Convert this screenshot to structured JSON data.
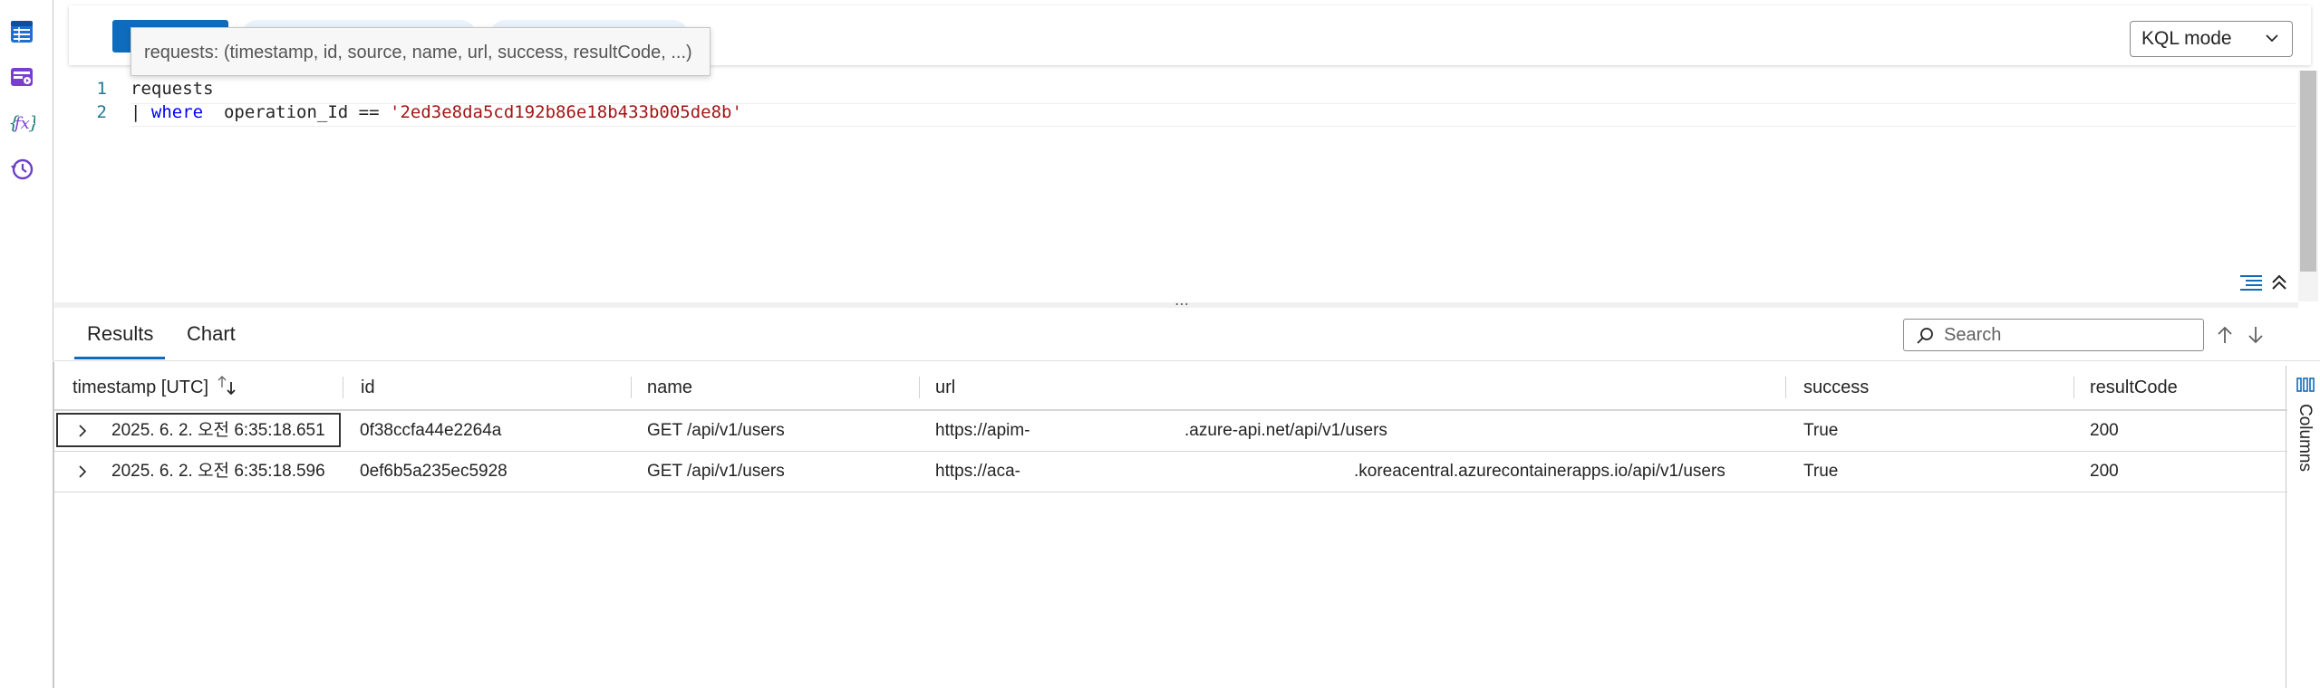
{
  "tooltip": {
    "text": "requests: (timestamp, id, source, name, url, success, resultCode, ...)"
  },
  "mode_select": {
    "value": "KQL mode"
  },
  "editor": {
    "line_numbers": [
      "1",
      "2"
    ],
    "line1": "requests",
    "line2_pipe": "| ",
    "line2_kw": "where",
    "line2_mid": "  operation_Id == ",
    "line2_str": "'2ed3e8da5cd192b86e18b433b005de8b'"
  },
  "results_tabs": [
    {
      "label": "Results",
      "active": true
    },
    {
      "label": "Chart",
      "active": false
    }
  ],
  "search": {
    "placeholder": "Search"
  },
  "grid": {
    "columns": [
      "timestamp [UTC]",
      "id",
      "name",
      "url",
      "success",
      "resultCode"
    ],
    "rows": [
      {
        "timestamp": "2025. 6. 2. 오전 6:35:18.651",
        "id": "0f38ccfa44e2264a",
        "name": "GET /api/v1/users",
        "url_start": "https://apim-",
        "url_end": ".azure-api.net/api/v1/users",
        "success": "True",
        "resultCode": "200"
      },
      {
        "timestamp": "2025. 6. 2. 오전 6:35:18.596",
        "id": "0ef6b5a235ec5928",
        "name": "GET /api/v1/users",
        "url_start": "https://aca-",
        "url_end": ".koreacentral.azurecontainerapps.io/api/v1/users",
        "success": "True",
        "resultCode": "200"
      }
    ]
  },
  "columns_panel": {
    "label": "Columns"
  },
  "colors": {
    "accent": "#0f6cbd",
    "keyword": "#0000ff",
    "string": "#a31515",
    "line_number": "#237893"
  },
  "icons": [
    "table-icon",
    "query-explorer-icon",
    "function-icon",
    "history-icon",
    "format-icon",
    "collapse-icon",
    "search-icon",
    "arrow-up-icon",
    "arrow-down-icon",
    "expand-row-icon",
    "sort-icon",
    "chevron-down-icon",
    "columns-icon"
  ]
}
